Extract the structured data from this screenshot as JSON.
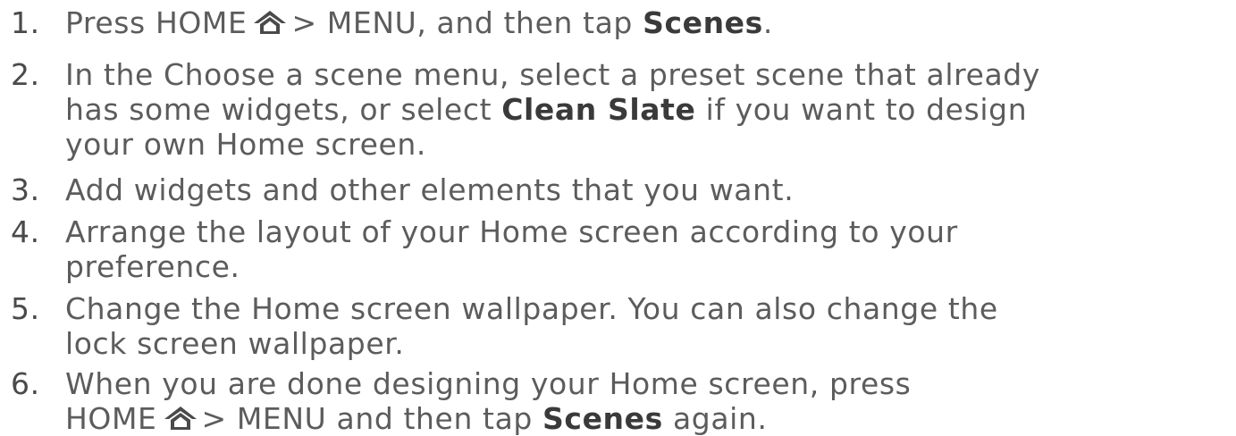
{
  "steps": [
    {
      "number": "1.",
      "home": "Press HOME",
      "after_icon": "> MENU, and then tap",
      "bold": "Scenes",
      "end": "."
    },
    {
      "number": "2.",
      "line1": "In the Choose a scene menu, select a preset scene that already",
      "line2_pre": "has some widgets, or select",
      "bold": "Clean Slate",
      "line2_post": "if you want to design",
      "line3": "your own Home screen."
    },
    {
      "number": "3.",
      "line1": "Add widgets and other elements that you want."
    },
    {
      "number": "4.",
      "line1": "Arrange the layout of your Home screen according to your",
      "line2": "preference."
    },
    {
      "number": "5.",
      "line1": "Change the Home screen wallpaper. You can also change the",
      "line2": "lock screen wallpaper."
    },
    {
      "number": "6.",
      "line1": "When you are done designing your Home screen, press",
      "home": "HOME",
      "after_icon": "> MENU and then tap",
      "bold": "Scenes",
      "end": "again."
    }
  ],
  "icons": {
    "home": "home-icon",
    "color": "#4a4a4a"
  }
}
